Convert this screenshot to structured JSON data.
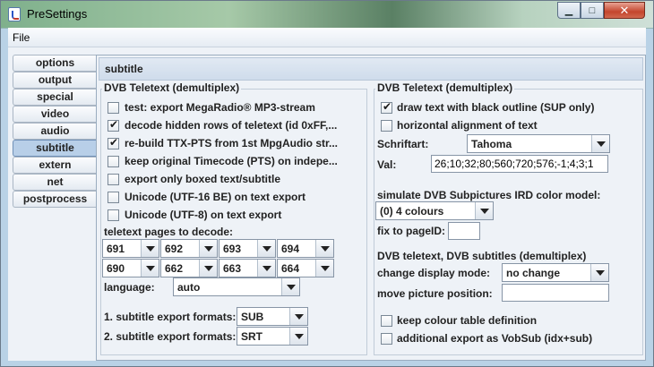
{
  "window": {
    "title": "PreSettings"
  },
  "menu": {
    "file": "File"
  },
  "tabs": [
    "options",
    "output",
    "special",
    "video",
    "audio",
    "subtitle",
    "extern",
    "net",
    "postprocess"
  ],
  "active_tab": "subtitle",
  "panel_title": "subtitle",
  "left": {
    "group_label": "DVB Teletext (demultiplex)",
    "checkboxes": [
      {
        "label": "test: export MegaRadio® MP3-stream",
        "checked": false
      },
      {
        "label": "decode hidden rows of teletext (id 0xFF,...",
        "checked": true
      },
      {
        "label": "re-build TTX-PTS from 1st MpgAudio str...",
        "checked": true
      },
      {
        "label": "keep original Timecode (PTS) on indepe...",
        "checked": false
      },
      {
        "label": "export only boxed text/subtitle",
        "checked": false
      },
      {
        "label": "Unicode (UTF-16 BE) on text export",
        "checked": false
      },
      {
        "label": "Unicode (UTF-8) on text export",
        "checked": false
      }
    ],
    "pages_label": "teletext pages to decode:",
    "pages": [
      "691",
      "692",
      "693",
      "694",
      "690",
      "662",
      "663",
      "664"
    ],
    "language_label": "language:",
    "language_value": "auto",
    "export1_label": "1. subtitle export formats:",
    "export1_value": "SUB",
    "export2_label": "2. subtitle export formats:",
    "export2_value": "SRT"
  },
  "right": {
    "group_label": "DVB Teletext (demultiplex)",
    "outline": {
      "label": "draw text with black outline (SUP only)",
      "checked": true
    },
    "halign": {
      "label": "horizontal alignment of text",
      "checked": false
    },
    "font_label": "Schriftart:",
    "font_value": "Tahoma",
    "val_label": "Val:",
    "val_value": "26;10;32;80;560;720;576;-1;4;3;1",
    "ird_label": "simulate DVB Subpictures IRD color model:",
    "ird_value": "(0) 4 colours",
    "pageid_label": "fix to pageID:",
    "pageid_value": "",
    "dvb_label": "DVB teletext, DVB subtitles (demultiplex)",
    "display_label": "change display mode:",
    "display_value": "no change",
    "move_label": "move picture position:",
    "move_value": "",
    "keep_colour": {
      "label": "keep colour table definition",
      "checked": false
    },
    "vobsub": {
      "label": "additional export as VobSub (idx+sub)",
      "checked": false
    }
  },
  "icons": {
    "app": "app-icon",
    "minimize": "minimize-icon",
    "maximize": "maximize-icon",
    "close": "close-icon"
  }
}
